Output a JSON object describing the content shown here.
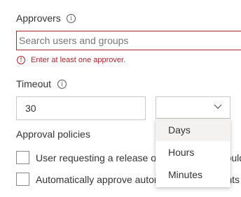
{
  "approvers": {
    "label": "Approvers",
    "info_icon": "info-icon",
    "search": {
      "placeholder": "Search users and groups",
      "value": ""
    },
    "error": {
      "icon": "error-circle-icon",
      "message": "Enter at least one approver."
    }
  },
  "timeout": {
    "label": "Timeout",
    "info_icon": "info-icon",
    "value": "30",
    "unit": {
      "selected": "",
      "expanded": true,
      "options": [
        "Days",
        "Hours",
        "Minutes"
      ]
    }
  },
  "approval_policies": {
    "label": "Approval policies",
    "items": [
      {
        "label": "User requesting a release or deployment should not approve it",
        "checked": false
      },
      {
        "label": "Automatically approve automated deployments",
        "checked": false
      }
    ]
  },
  "colors": {
    "error": "#a4262c",
    "border": "#c8c8c8",
    "text": "#333333",
    "option_hover": "#f3f2f1"
  }
}
